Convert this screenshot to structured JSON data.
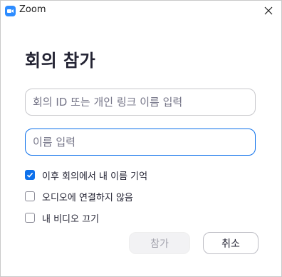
{
  "window": {
    "title": "Zoom",
    "icon": "zoom-camera-icon",
    "close_icon": "close-icon"
  },
  "dialog": {
    "heading": "회의 참가",
    "meeting_input": {
      "placeholder": "회의 ID 또는 개인 링크 이름 입력",
      "value": ""
    },
    "name_input": {
      "placeholder": "이름 입력",
      "value": ""
    },
    "options": [
      {
        "label": "이후 회의에서 내 이름 기억",
        "checked": true
      },
      {
        "label": "오디오에 연결하지 않음",
        "checked": false
      },
      {
        "label": "내 비디오 끄기",
        "checked": false
      }
    ],
    "join_label": "참가",
    "cancel_label": "취소"
  },
  "colors": {
    "accent": "#0e71eb",
    "zoom_brand": "#2d8cff",
    "disabled_bg": "#f2f2f4",
    "disabled_text": "#a3a3ad"
  }
}
